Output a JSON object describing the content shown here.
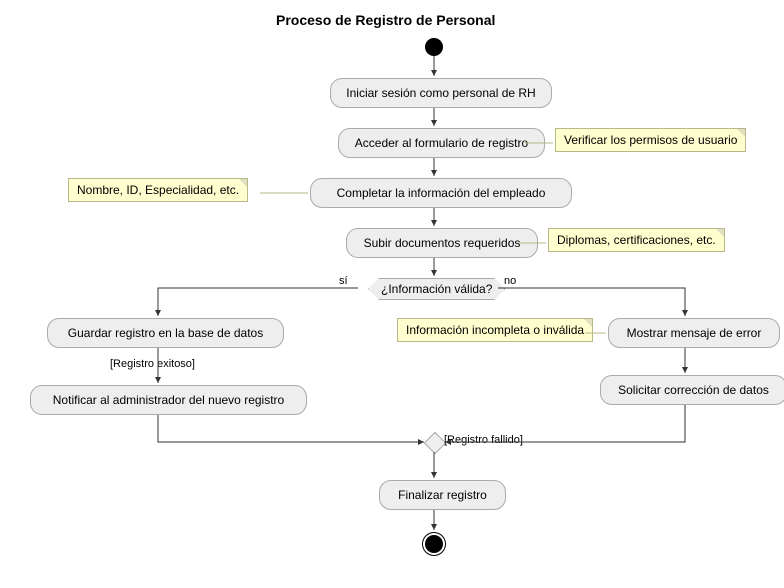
{
  "title": "Proceso de Registro de Personal",
  "nodes": {
    "n1": "Iniciar sesión como personal de RH",
    "n2": "Acceder al formulario de registro",
    "n3": "Completar la información del empleado",
    "n4": "Subir documentos requeridos",
    "decision": "¿Información válida?",
    "n5": "Guardar registro en la base de datos",
    "n6": "Notificar al administrador del nuevo registro",
    "n7": "Mostrar mensaje de error",
    "n8": "Solicitar corrección de datos",
    "n9": "Finalizar registro"
  },
  "notes": {
    "note1": "Verificar los permisos de usuario",
    "note2": "Nombre, ID, Especialidad, etc.",
    "note3": "Diplomas, certificaciones, etc.",
    "note4": "Información incompleta o inválida"
  },
  "labels": {
    "yes": "sí",
    "no": "no",
    "success": "[Registro exitoso]",
    "fail": "[Registro fallido]"
  }
}
